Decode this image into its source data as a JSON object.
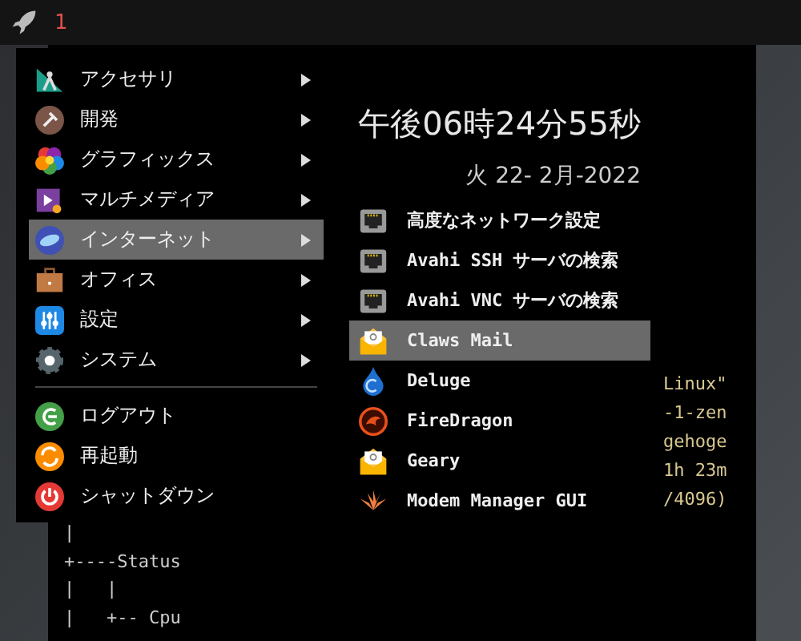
{
  "panel": {
    "workspace": "1"
  },
  "terminal": {
    "tree_lines": [
      "|",
      "+----Status",
      "|   |",
      "|   +-- Cpu"
    ],
    "side_lines": [
      "Linux\"",
      "-1-zen",
      "gehoge",
      "1h 23m",
      "/4096)"
    ]
  },
  "menu": {
    "categories": [
      {
        "label": "アクセサリ",
        "selected": false
      },
      {
        "label": "開発",
        "selected": false
      },
      {
        "label": "グラフィックス",
        "selected": false
      },
      {
        "label": "マルチメディア",
        "selected": false
      },
      {
        "label": "インターネット",
        "selected": true
      },
      {
        "label": "オフィス",
        "selected": false
      },
      {
        "label": "設定",
        "selected": false
      },
      {
        "label": "システム",
        "selected": false
      }
    ],
    "session": [
      "ログアウト",
      "再起動",
      "シャットダウン"
    ],
    "clock": {
      "time": "午後06時24分55秒",
      "date": "火 22- 2月-2022"
    },
    "apps": [
      {
        "label": "高度なネットワーク設定",
        "selected": false
      },
      {
        "label": "Avahi SSH サーバの検索",
        "selected": false
      },
      {
        "label": "Avahi VNC サーバの検索",
        "selected": false
      },
      {
        "label": "Claws Mail",
        "selected": true
      },
      {
        "label": "Deluge",
        "selected": false
      },
      {
        "label": "FireDragon",
        "selected": false
      },
      {
        "label": "Geary",
        "selected": false
      },
      {
        "label": "Modem Manager GUI",
        "selected": false
      }
    ]
  }
}
